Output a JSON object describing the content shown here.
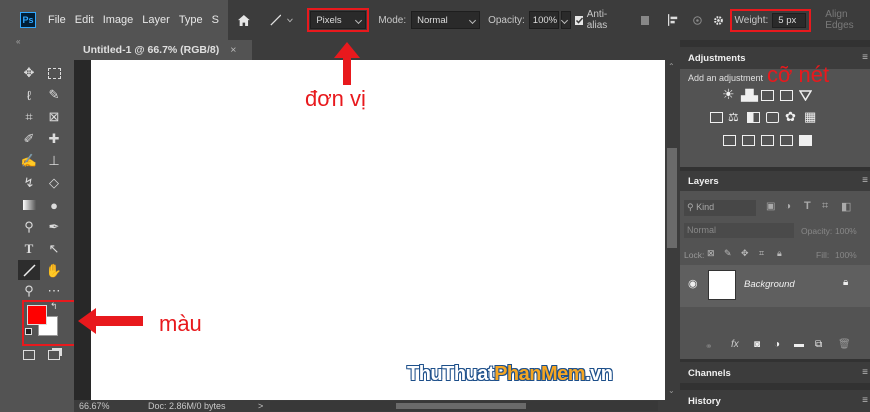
{
  "app": {
    "logo": "Ps"
  },
  "menu": [
    "File",
    "Edit",
    "Image",
    "Layer",
    "Type",
    "S"
  ],
  "options": {
    "units_value": "Pixels",
    "mode_label": "Mode:",
    "mode_value": "Normal",
    "opacity_label": "Opacity:",
    "opacity_value": "100%",
    "antialias_label": "Anti-alias",
    "weight_label": "Weight:",
    "weight_value": "5 px",
    "align_edges_label": "Align Edges"
  },
  "document": {
    "tab_title": "Untitled-1 @ 66.7% (RGB/8)",
    "tab_close": "×"
  },
  "status": {
    "zoom": "66.67%",
    "doc_info": "Doc: 2.86M/0 bytes",
    "arrow": ">"
  },
  "panels": {
    "adjustments": {
      "title": "Adjustments",
      "hint": "Add an adjustment"
    },
    "layers": {
      "title": "Layers",
      "kind": "Kind",
      "blend": "Normal",
      "opacity_label": "Opacity:",
      "opacity_value": "100%",
      "lock_label": "Lock:",
      "fill_label": "Fill:",
      "fill_value": "100%",
      "layer_name": "Background"
    },
    "channels": {
      "title": "Channels"
    },
    "history": {
      "title": "History"
    }
  },
  "annotations": {
    "unit": "đơn vị",
    "stroke_width": "cỡ nét",
    "color": "màu",
    "watermark_thu": "ThuThuat",
    "watermark_phan": "PhanMem",
    "watermark_vn": ".vn"
  },
  "colors": {
    "foreground": "#ff0000",
    "background": "#ffffff",
    "annotation_red": "#e8191d",
    "ps_blue": "#31a8ff"
  }
}
